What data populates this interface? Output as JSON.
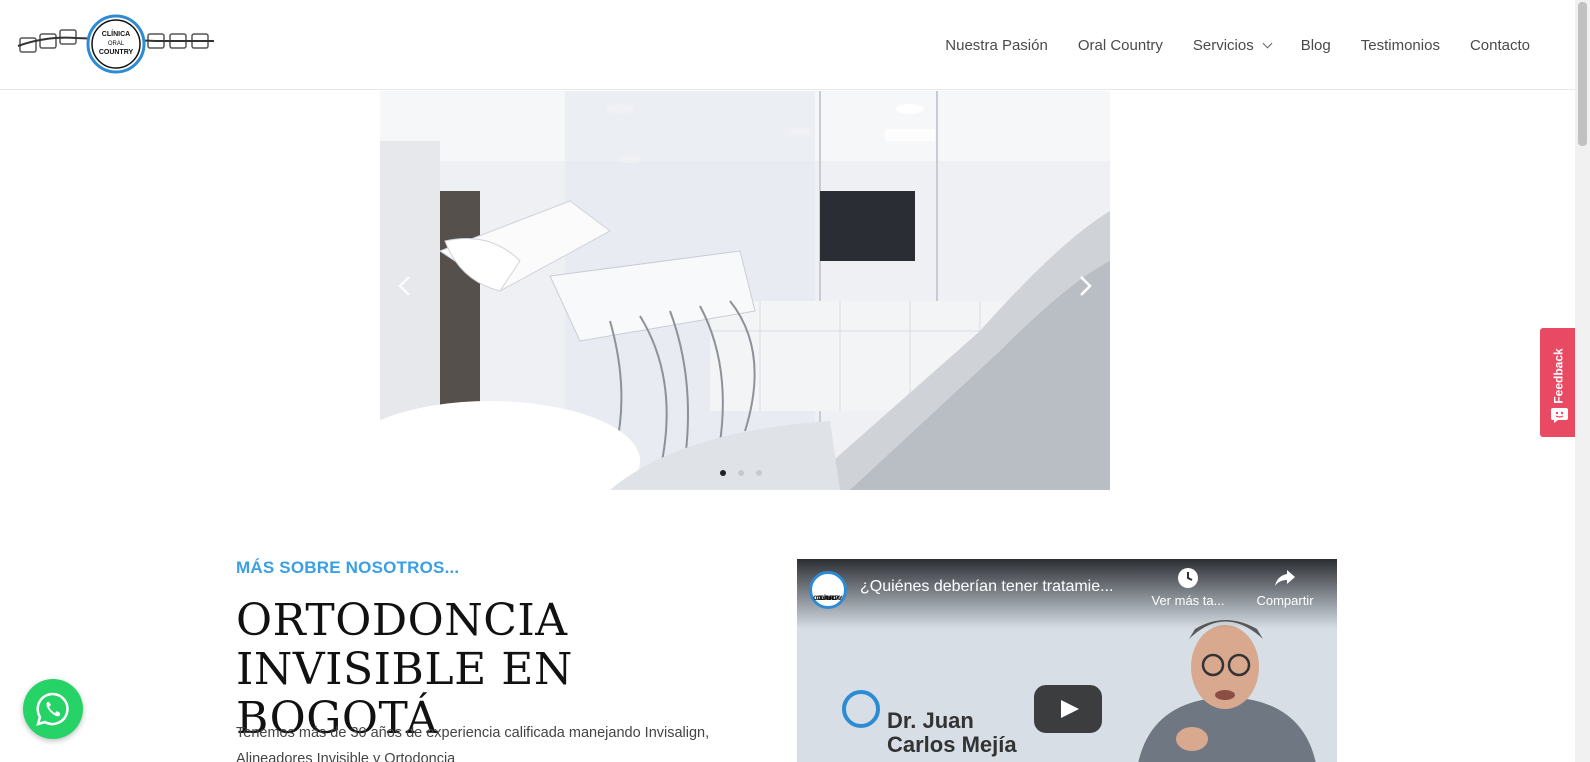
{
  "brand": {
    "logo_text_top": "CLÍNICA",
    "logo_text_mid": "ORAL",
    "logo_text_bottom": "COUNTRY",
    "accent": "#3a9fe3"
  },
  "nav": {
    "items": [
      {
        "label": "Nuestra Pasión"
      },
      {
        "label": "Oral Country"
      },
      {
        "label": "Servicios"
      },
      {
        "label": "Blog"
      },
      {
        "label": "Testimonios"
      },
      {
        "label": "Contacto"
      }
    ]
  },
  "slider": {
    "active_index": 0,
    "slide_count": 3
  },
  "feedback": {
    "label": "Feedback",
    "color": "#e84a63"
  },
  "about": {
    "kicker": "MÁS SOBRE NOSOTROS...",
    "headline_line1": "ORTODONCIA",
    "headline_line2": "INVISIBLE EN BOGOTÁ",
    "intro_line1": "Tenemos más de 30 años de experiencia calificada manejando Invisalign,",
    "intro_line2": "Alineadores Invisible y Ortodoncia"
  },
  "video": {
    "channel_logo_line1": "CLÍNICA",
    "channel_logo_line2": "ORAL",
    "channel_logo_line3": "COUNTRY",
    "title": "¿Quiénes deberían tener tratamie...",
    "watch_later": "Ver más ta...",
    "share": "Compartir",
    "name_line1": "Dr. Juan",
    "name_line2": "Carlos Mejía"
  },
  "whatsapp": {
    "icon": "whatsapp-icon",
    "color": "#25d366"
  }
}
